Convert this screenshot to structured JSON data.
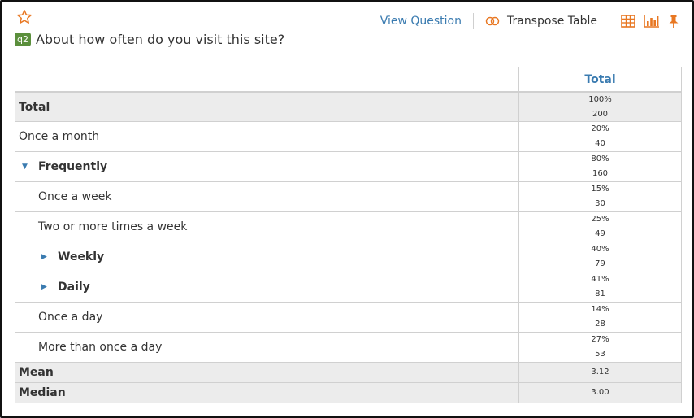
{
  "toolbar": {
    "view_question": "View Question",
    "transpose": "Transpose Table"
  },
  "question": {
    "badge": "q2",
    "text": "About how often do you visit this site?"
  },
  "table": {
    "column_header": "Total",
    "rows": [
      {
        "label": "Total",
        "pct": "100%",
        "count": "200"
      },
      {
        "label": "Once a month",
        "pct": "20%",
        "count": "40"
      },
      {
        "label": "Frequently",
        "pct": "80%",
        "count": "160"
      },
      {
        "label": "Once a week",
        "pct": "15%",
        "count": "30"
      },
      {
        "label": "Two or more times a week",
        "pct": "25%",
        "count": "49"
      },
      {
        "label": "Weekly",
        "pct": "40%",
        "count": "79"
      },
      {
        "label": "Daily",
        "pct": "41%",
        "count": "81"
      },
      {
        "label": "Once a day",
        "pct": "14%",
        "count": "28"
      },
      {
        "label": "More than once a day",
        "pct": "27%",
        "count": "53"
      }
    ],
    "mean": {
      "label": "Mean",
      "value": "3.12"
    },
    "median": {
      "label": "Median",
      "value": "3.00"
    }
  },
  "colors": {
    "accent": "#3a7bb0",
    "icon_orange": "#e87722",
    "badge_green": "#5b8f3c",
    "summary_gray": "#ececec"
  }
}
